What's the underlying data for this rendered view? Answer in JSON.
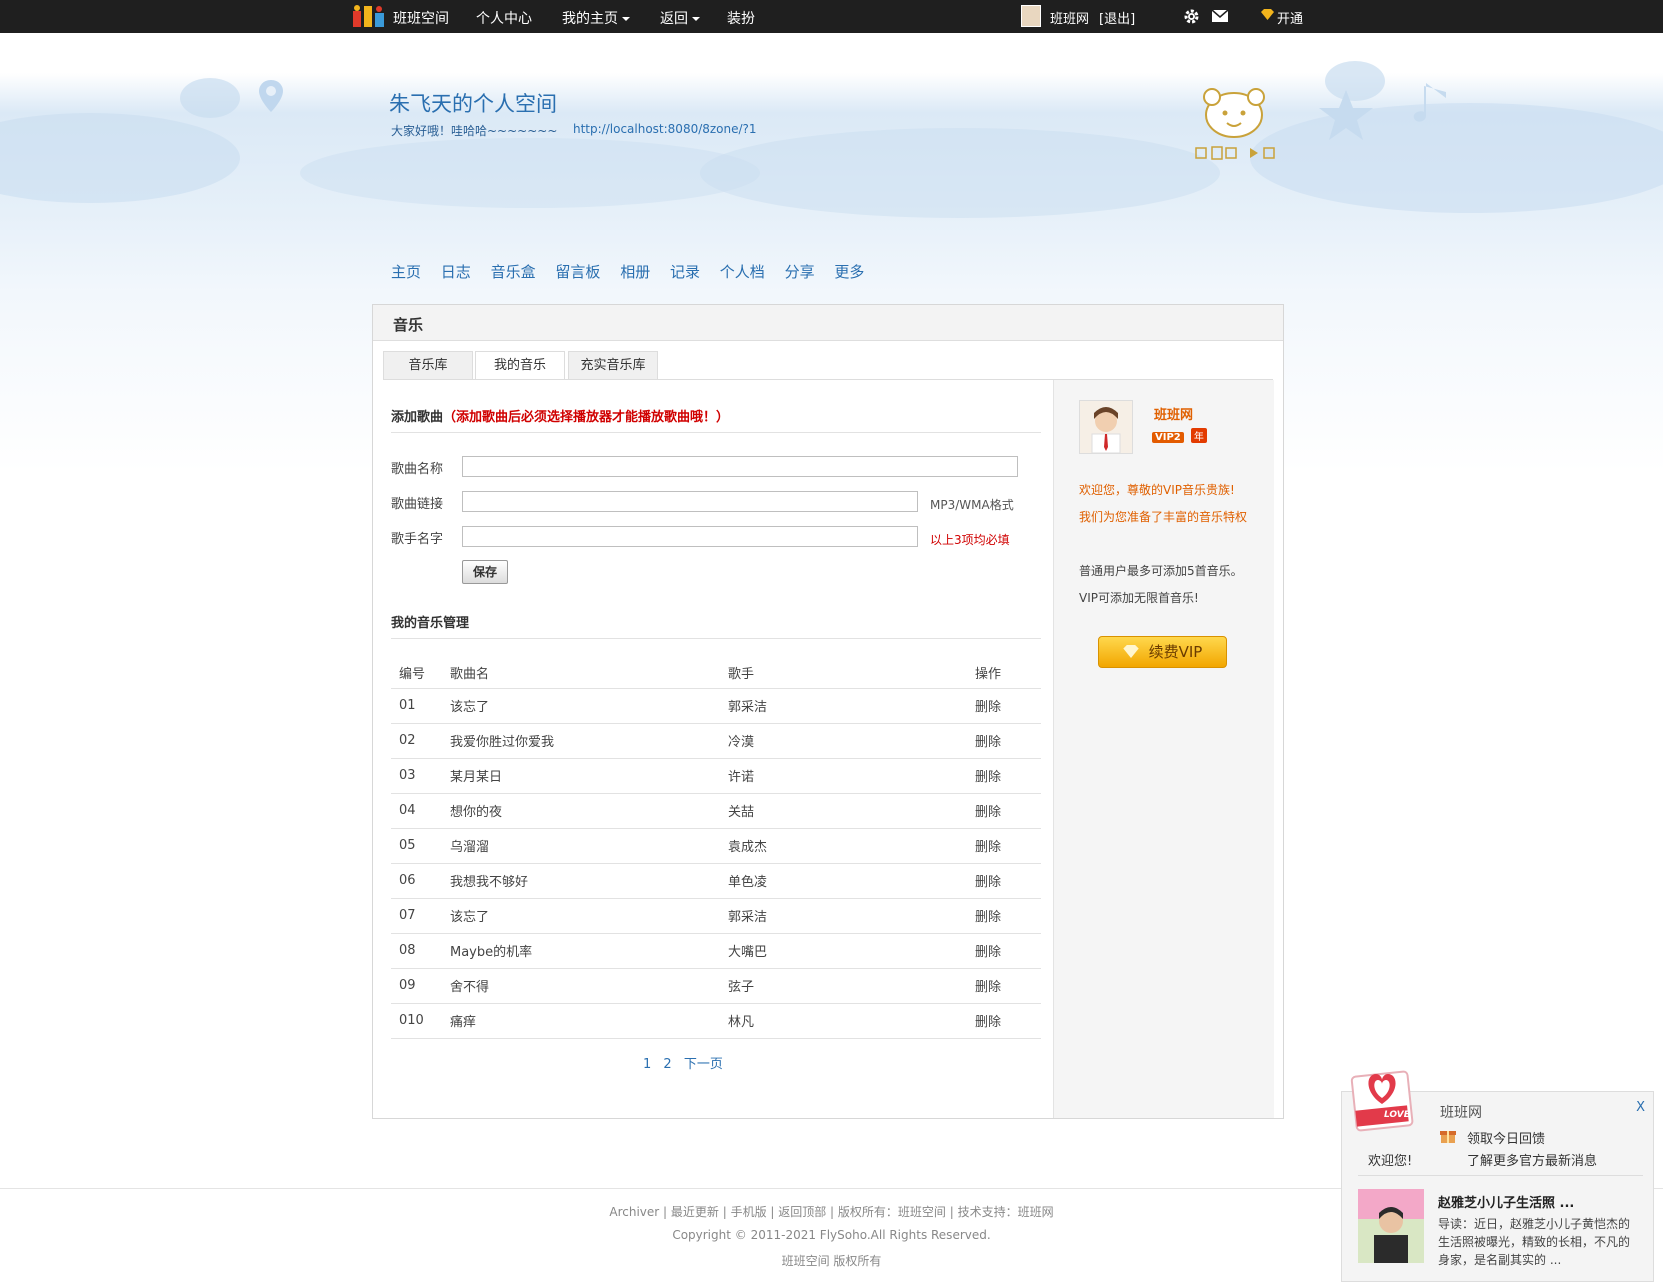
{
  "topbar": {
    "brand": "班班空间",
    "personal_center": "个人中心",
    "my_home": "我的主页",
    "back": "返回",
    "decorate": "装扮",
    "user": "班班网",
    "logout": "[退出]",
    "open": "开通",
    "icons": [
      "gear-icon",
      "mail-icon",
      "diamond-icon"
    ]
  },
  "header": {
    "title": "朱飞天的个人空间",
    "greeting": "大家好哦！哇哈哈~~~~~~~",
    "url": "http://localhost:8080/8zone/?1"
  },
  "nav": [
    "主页",
    "日志",
    "音乐盒",
    "留言板",
    "相册",
    "记录",
    "个人档",
    "分享",
    "更多"
  ],
  "panel": {
    "title": "音乐",
    "tabs": [
      "音乐库",
      "我的音乐",
      "充实音乐库"
    ]
  },
  "add_song": {
    "title": "添加歌曲",
    "warning": "（添加歌曲后必须选择播放器才能播放歌曲哦！）",
    "fields": {
      "name_label": "歌曲名称",
      "link_label": "歌曲链接",
      "singer_label": "歌手名字",
      "format_hint": "MP3/WMA格式",
      "required_hint": "以上3项均必填"
    },
    "save": "保存"
  },
  "music_manage": {
    "title": "我的音乐管理",
    "columns": [
      "编号",
      "歌曲名",
      "歌手",
      "操作"
    ],
    "rows": [
      {
        "no": "01",
        "name": "该忘了",
        "singer": "郭采洁",
        "op": "删除"
      },
      {
        "no": "02",
        "name": "我爱你胜过你爱我",
        "singer": "冷漠",
        "op": "删除"
      },
      {
        "no": "03",
        "name": "某月某日",
        "singer": "许诺",
        "op": "删除"
      },
      {
        "no": "04",
        "name": "想你的夜",
        "singer": "关喆",
        "op": "删除"
      },
      {
        "no": "05",
        "name": "乌溜溜",
        "singer": "袁成杰",
        "op": "删除"
      },
      {
        "no": "06",
        "name": "我想我不够好",
        "singer": "单色凌",
        "op": "删除"
      },
      {
        "no": "07",
        "name": "该忘了",
        "singer": "郭采洁",
        "op": "删除"
      },
      {
        "no": "08",
        "name": "Maybe的机率",
        "singer": "大嘴巴",
        "op": "删除"
      },
      {
        "no": "09",
        "name": "舍不得",
        "singer": "弦子",
        "op": "删除"
      },
      {
        "no": "010",
        "name": "痛痒",
        "singer": "林凡",
        "op": "删除"
      }
    ],
    "pager": [
      "1",
      "2",
      "下一页"
    ]
  },
  "sidebar": {
    "username": "班班网",
    "vip_badge": "VIP2",
    "year_badge": "年",
    "welcome": "欢迎您，尊敬的VIP音乐贵族!",
    "privilege": "我们为您准备了丰富的音乐特权",
    "normal_limit": "普通用户最多可添加5首音乐。",
    "vip_limit": "VIP可添加无限首音乐!",
    "renew": "续费VIP"
  },
  "footer": {
    "links": "Archiver | 最近更新 | 手机版 | 返回顶部 | 版权所有：班班空间 | 技术支持：班班网",
    "copyright": "Copyright © 2011-2021 FlySoho.All Rights Reserved.",
    "rights": "班班空间 版权所有"
  },
  "popup": {
    "site": "班班网",
    "close": "X",
    "daily_gift": "领取今日回馈",
    "welcome": "欢迎您!",
    "news": "了解更多官方最新消息",
    "headline": "赵雅芝小儿子生活照 ...",
    "summary_1": "导读：近日，赵雅芝小儿子黄恺杰的",
    "summary_2": "生活照被曝光，精致的长相，不凡的",
    "summary_3": "身家，是名副其实的 ...",
    "love": "LOVE"
  },
  "colors": {
    "topbar": "#1f1f1f",
    "link": "#2a6fb0",
    "warning": "#d00000",
    "vip_orange": "#e06000",
    "vip_button": "#f2a600"
  }
}
